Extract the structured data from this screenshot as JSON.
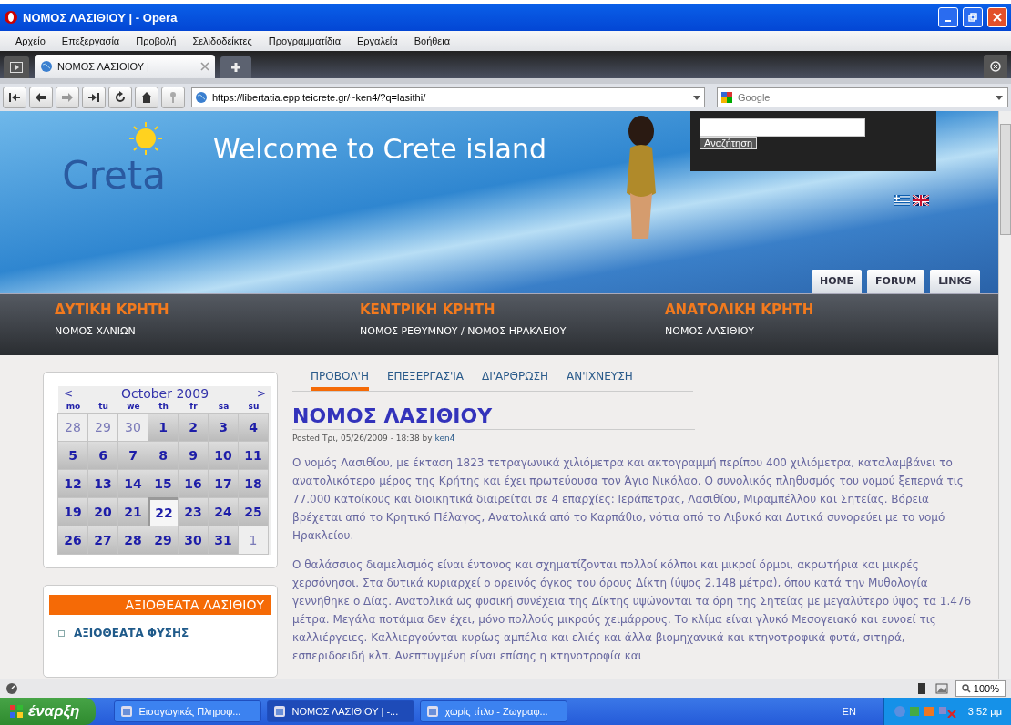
{
  "window": {
    "title": "ΝΟΜΟΣ ΛΑΣΙΘΙΟΥ |  - Opera"
  },
  "menu": [
    "Αρχείο",
    "Επεξεργασία",
    "Προβολή",
    "Σελιδοδείκτες",
    "Προγραμματίδια",
    "Εργαλεία",
    "Βοήθεια"
  ],
  "tabs": [
    {
      "label": "ΝΟΜΟΣ ΛΑΣΙΘΙΟΥ |",
      "selected": true
    }
  ],
  "address": {
    "url": "https://libertatia.epp.teicrete.gr/~ken4/?q=lasithi/",
    "search_placeholder": "Google"
  },
  "banner": {
    "logo": "Creta",
    "welcome": "Welcome to Crete island",
    "search_button": "Αναζήτηση",
    "nav": [
      "HOME",
      "FORUM",
      "LINKS"
    ]
  },
  "regions": [
    {
      "title": "ΔΥΤΙΚΗ ΚΡΗΤΗ",
      "subtitle": "ΝΟΜΟΣ ΧΑΝΙΩΝ"
    },
    {
      "title": "ΚΕΝΤΡΙΚΗ ΚΡΗΤΗ",
      "subtitle": "ΝΟΜΟΣ ΡΕΘΥΜΝΟΥ / ΝΟΜΟΣ ΗΡΑΚΛΕΙΟΥ"
    },
    {
      "title": "ΑΝΑΤΟΛΙΚΗ ΚΡΗΤΗ",
      "subtitle": "ΝΟΜΟΣ ΛΑΣΙΘΙΟΥ"
    }
  ],
  "calendar": {
    "prev": "<",
    "month": "October 2009",
    "next": ">",
    "weekdays": [
      "mo",
      "tu",
      "we",
      "th",
      "fr",
      "sa",
      "su"
    ],
    "days": [
      {
        "label": "28",
        "kind": "other",
        "selected": false
      },
      {
        "label": "29",
        "kind": "other",
        "selected": false
      },
      {
        "label": "30",
        "kind": "other",
        "selected": false
      },
      {
        "label": "1",
        "kind": "day",
        "selected": false
      },
      {
        "label": "2",
        "kind": "day",
        "selected": false
      },
      {
        "label": "3",
        "kind": "day",
        "selected": false
      },
      {
        "label": "4",
        "kind": "day",
        "selected": false
      },
      {
        "label": "5",
        "kind": "day",
        "selected": false
      },
      {
        "label": "6",
        "kind": "day",
        "selected": false
      },
      {
        "label": "7",
        "kind": "day",
        "selected": false
      },
      {
        "label": "8",
        "kind": "day",
        "selected": false
      },
      {
        "label": "9",
        "kind": "day",
        "selected": false
      },
      {
        "label": "10",
        "kind": "day",
        "selected": false
      },
      {
        "label": "11",
        "kind": "day",
        "selected": false
      },
      {
        "label": "12",
        "kind": "day",
        "selected": false
      },
      {
        "label": "13",
        "kind": "day",
        "selected": false
      },
      {
        "label": "14",
        "kind": "day",
        "selected": false
      },
      {
        "label": "15",
        "kind": "day",
        "selected": false
      },
      {
        "label": "16",
        "kind": "day",
        "selected": false
      },
      {
        "label": "17",
        "kind": "day",
        "selected": false
      },
      {
        "label": "18",
        "kind": "day",
        "selected": false
      },
      {
        "label": "19",
        "kind": "day",
        "selected": false
      },
      {
        "label": "20",
        "kind": "day",
        "selected": false
      },
      {
        "label": "21",
        "kind": "day",
        "selected": false
      },
      {
        "label": "22",
        "kind": "day",
        "selected": true
      },
      {
        "label": "23",
        "kind": "day",
        "selected": false
      },
      {
        "label": "24",
        "kind": "day",
        "selected": false
      },
      {
        "label": "25",
        "kind": "day",
        "selected": false
      },
      {
        "label": "26",
        "kind": "day",
        "selected": false
      },
      {
        "label": "27",
        "kind": "day",
        "selected": false
      },
      {
        "label": "28",
        "kind": "day",
        "selected": false
      },
      {
        "label": "29",
        "kind": "day",
        "selected": false
      },
      {
        "label": "30",
        "kind": "day",
        "selected": false
      },
      {
        "label": "31",
        "kind": "day",
        "selected": false
      },
      {
        "label": "1",
        "kind": "other",
        "selected": false
      }
    ]
  },
  "sights": {
    "title": "ΑΞΙΟΘΕΑΤΑ ΛΑΣΙΘΙΟΥ",
    "items": [
      "ΑΞΙΟΘΕΑΤΑ ΦΥΣΗΣ"
    ]
  },
  "content_tabs": [
    {
      "label": "ΠΡΟΒΟΛ'Η",
      "selected": true
    },
    {
      "label": "ΕΠΕΞΕΡΓΑΣ'ΙΑ",
      "selected": false
    },
    {
      "label": "ΔΙ'ΑΡΘΡΩΣΗ",
      "selected": false
    },
    {
      "label": "ΑΝ'ΙΧΝΕΥΣΗ",
      "selected": false
    }
  ],
  "article": {
    "title": "ΝΟΜΟΣ ΛΑΣΙΘΙΟΥ",
    "posted": "Posted Τρι, 05/26/2009 - 18:38 by",
    "author": "ken4",
    "paragraphs": [
      "Ο νομός Λασιθίου, με έκταση 1823 τετραγωνικά χιλιόμετρα και ακτογραμμή περίπου 400 χιλιόμετρα, καταλαμβάνει το ανατολικότερο μέρος της Κρήτης και έχει πρωτεύουσα τον Άγιο Νικόλαο. Ο συνολικός πληθυσμός του νομού ξεπερνά τις 77.000 κατοίκους και διοικητικά διαιρείται σε 4 επαρχίες: Ιεράπετρας, Λασιθίου, Μιραμπέλλου και Σητείας. Βόρεια βρέχεται από το Κρητικό Πέλαγος, Ανατολικά από το Καρπάθιο, νότια από το Λιβυκό και Δυτικά συνορεύει με το νομό Ηρακλείου.",
      "Ο θαλάσσιος διαμελισμός είναι έντονος και σχηματίζονται πολλοί κόλποι και μικροί όρμοι, ακρωτήρια και μικρές χερσόνησοι. Στα δυτικά κυριαρχεί ο ορεινός όγκος του όρους Δίκτη (ύψος 2.148 μέτρα), όπου κατά την Μυθολογία γεννήθηκε ο Δίας. Ανατολικά ως φυσική συνέχεια της Δίκτης υψώνονται τα όρη της Σητείας με μεγαλύτερο ύψος τα 1.476 μέτρα. Μεγάλα ποτάμια δεν έχει, μόνο πολλούς μικρούς χειμάρρους. Το κλίμα είναι γλυκό Μεσογειακό και ευνοεί τις καλλιέργειες. Καλλιεργούνται κυρίως αμπέλια και ελιές και άλλα βιομηχανικά και κτηνοτροφικά φυτά, σιτηρά, εσπεριδοειδή κλπ. Ανεπτυγμένη είναι επίσης η κτηνοτροφία και"
    ]
  },
  "status_bar": {
    "zoom": "100%"
  },
  "taskbar": {
    "start": "έναρξη",
    "tasks": [
      {
        "label": "Εισαγωγικές Πληροφ...",
        "selected": false
      },
      {
        "label": "ΝΟΜΟΣ ΛΑΣΙΘΙΟΥ | -...",
        "selected": true
      },
      {
        "label": "χωρίς τίτλο - Ζωγραφ...",
        "selected": false
      }
    ],
    "language": "EN",
    "clock": "3:52 μμ"
  }
}
